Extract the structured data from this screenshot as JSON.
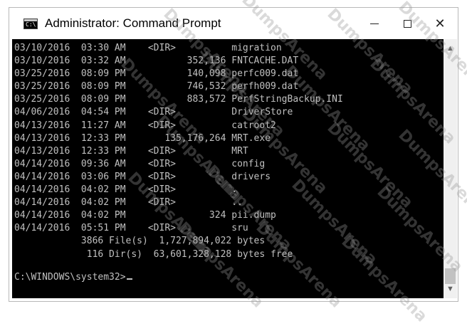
{
  "window": {
    "title": "Administrator: Command Prompt",
    "icon_label": "C:\\",
    "controls": {
      "minimize_icon": "minimize-icon",
      "maximize_icon": "maximize-icon",
      "close_icon": "close-icon",
      "close_glyph": "✕"
    }
  },
  "console": {
    "text_color": "#c0c0c0",
    "background": "#000000",
    "lines": [
      "03/10/2016  03:30 AM    <DIR>          migration",
      "03/10/2016  03:32 AM           352,136 FNTCACHE.DAT",
      "03/25/2016  08:09 PM           140,098 perfc009.dat",
      "03/25/2016  08:09 PM           746,532 perfh009.dat",
      "03/25/2016  08:09 PM           883,572 PerfStringBackup.INI",
      "04/06/2016  04:54 PM    <DIR>          DriverStore",
      "04/13/2016  11:27 AM    <DIR>          catroot2",
      "04/13/2016  12:33 PM       135,176,264 MRT.exe",
      "04/13/2016  12:33 PM    <DIR>          MRT",
      "04/14/2016  09:36 AM    <DIR>          config",
      "04/14/2016  03:06 PM    <DIR>          drivers",
      "04/14/2016  04:02 PM    <DIR>          .",
      "04/14/2016  04:02 PM    <DIR>          ..",
      "04/14/2016  04:02 PM               324 pii.dump",
      "04/14/2016  05:51 PM    <DIR>          sru",
      "            3866 File(s)  1,727,894,022 bytes",
      "             116 Dir(s)  63,601,328,128 bytes free"
    ],
    "prompt": "C:\\WINDOWS\\system32>"
  },
  "scrollbar": {
    "up_icon": "scroll-up-arrow-icon",
    "down_icon": "scroll-down-arrow-icon",
    "up_glyph": "▲",
    "down_glyph": "▼"
  },
  "watermark": {
    "text": "DumpsArena"
  }
}
